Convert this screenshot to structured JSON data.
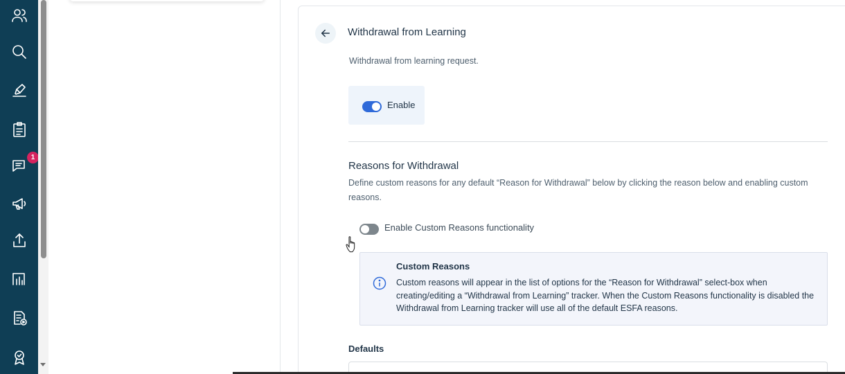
{
  "sidebar": {
    "items": [
      {
        "icon": "users-icon",
        "label": ""
      },
      {
        "icon": "search-icon",
        "label": ""
      },
      {
        "icon": "pen-icon",
        "label": ""
      },
      {
        "icon": "clipboard-icon",
        "label": ""
      },
      {
        "icon": "messages-icon",
        "badge": "1"
      },
      {
        "icon": "megaphone-icon",
        "label": ""
      },
      {
        "icon": "upload-icon",
        "label": ""
      },
      {
        "icon": "reports-icon",
        "label": ""
      },
      {
        "icon": "media-file-icon",
        "label": ""
      },
      {
        "icon": "award-icon",
        "label": ""
      }
    ]
  },
  "page": {
    "title": "Withdrawal from Learning",
    "description": "Withdrawal from learning request."
  },
  "enable": {
    "label": "Enable",
    "state": true
  },
  "reasons": {
    "title": "Reasons for Withdrawal",
    "description": "Define custom reasons for any default “Reason for Withdrawal” below by clicking the reason below and enabling custom reasons.",
    "custom_toggle_label": "Enable Custom Reasons functionality",
    "custom_toggle_state": false
  },
  "info": {
    "title": "Custom Reasons",
    "text": "Custom reasons will appear in the list of options for the “Reason for Withdrawal” select-box when creating/editing a “Withdrawal from Learning” tracker. When the Custom Reasons functionality is disabled the Withdrawal from Learning tracker will use all of the default ESFA reasons."
  },
  "defaults": {
    "title": "Defaults"
  },
  "colors": {
    "sidebar": "#0f3e55",
    "accent": "#2f6ad9",
    "badge": "#d6235f"
  }
}
